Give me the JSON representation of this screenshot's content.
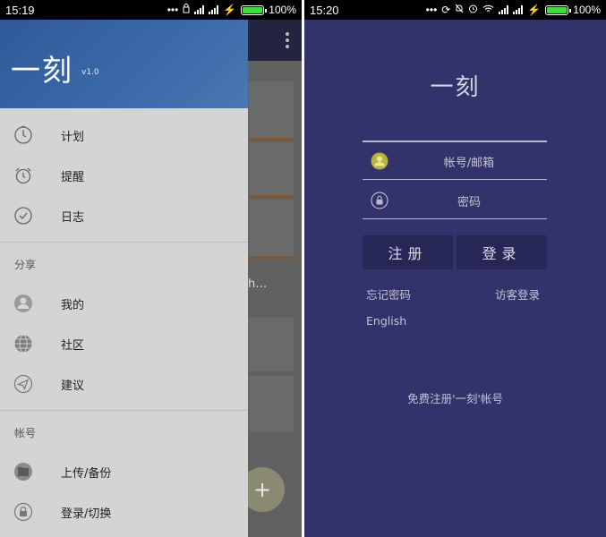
{
  "left": {
    "status": {
      "time": "15:19",
      "battery": "100%",
      "battery_level": 1.0
    },
    "drawer": {
      "title": "一刻",
      "version": "v1.0",
      "items_main": [
        {
          "label": "计划",
          "icon": "timer-icon"
        },
        {
          "label": "提醒",
          "icon": "alarm-clock-icon"
        },
        {
          "label": "日志",
          "icon": "check-circle-icon"
        }
      ],
      "section_share": "分享",
      "items_share": [
        {
          "label": "我的",
          "icon": "user-icon"
        },
        {
          "label": "社区",
          "icon": "globe-icon"
        },
        {
          "label": "建议",
          "icon": "send-icon"
        }
      ],
      "section_account": "帐号",
      "items_account": [
        {
          "label": "上传/备份",
          "icon": "folder-icon"
        },
        {
          "label": "登录/切换",
          "icon": "lock-icon"
        }
      ]
    },
    "background": {
      "truncated_text": "h…",
      "fab_label": "+"
    }
  },
  "right": {
    "status": {
      "time": "15:20",
      "battery": "100%",
      "battery_level": 1.0
    },
    "login": {
      "title": "一刻",
      "account_placeholder": "帐号/邮箱",
      "password_placeholder": "密码",
      "register_label": "注册",
      "login_label": "登录",
      "forgot_label": "忘记密码",
      "guest_label": "访客登录",
      "language_label": "English",
      "free_register_label": "免费注册'一刻'帐号"
    }
  },
  "colors": {
    "drawer_header": "#3c6aa8",
    "drawer_bg": "#d4d4d4",
    "login_bg": "#33336b",
    "login_button": "#272757",
    "battery_green": "#3ddc3d"
  }
}
